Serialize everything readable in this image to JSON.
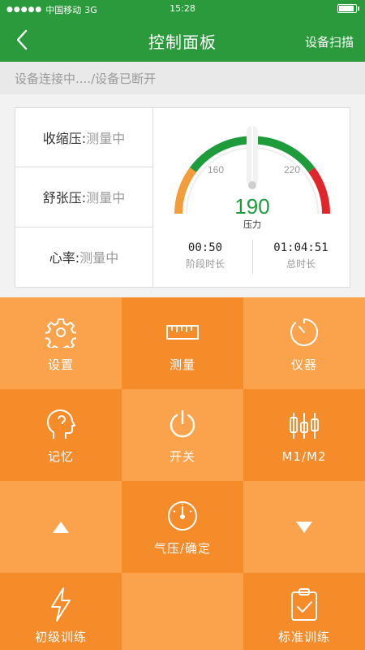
{
  "statusbar": {
    "carrier": "中国移动",
    "network": "3G",
    "time": "15:28"
  },
  "header": {
    "title": "控制面板",
    "right_action": "设备扫描",
    "back_icon": "chevron-left-icon"
  },
  "connection_status": "设备连接中..../设备已断开",
  "readings": [
    {
      "label": "收缩压:",
      "value": "测量中"
    },
    {
      "label": "舒张压:",
      "value": "测量中"
    },
    {
      "label": "心率:",
      "value": "测量中"
    }
  ],
  "gauge": {
    "value": "190",
    "unit_label": "压力",
    "tick_left": "160",
    "tick_right": "220",
    "colors": {
      "low": "#f39c3a",
      "normal": "#1e9b3a",
      "high": "#e0262b"
    }
  },
  "timers": [
    {
      "value": "00:50",
      "label": "阶段时长"
    },
    {
      "value": "01:04:51",
      "label": "总时长"
    }
  ],
  "controls": [
    {
      "label": "设置",
      "icon": "gear-icon"
    },
    {
      "label": "测量",
      "icon": "ruler-icon"
    },
    {
      "label": "仪器",
      "icon": "timer-icon"
    },
    {
      "label": "记忆",
      "icon": "head-memory-icon"
    },
    {
      "label": "开关",
      "icon": "power-icon"
    },
    {
      "label": "M1/M2",
      "icon": "candlestick-icon"
    },
    {
      "label": "",
      "icon": "up-arrow-icon"
    },
    {
      "label": "气压/确定",
      "icon": "pressure-gauge-icon"
    },
    {
      "label": "",
      "icon": "down-arrow-icon"
    },
    {
      "label": "初级训练",
      "icon": "lightning-icon"
    },
    {
      "label": "",
      "icon": ""
    },
    {
      "label": "标准训练",
      "icon": "clipboard-check-icon"
    }
  ],
  "theme": {
    "primary": "#2b9a3c",
    "tile_light": "#fba34c",
    "tile_dark": "#f68b2a"
  }
}
